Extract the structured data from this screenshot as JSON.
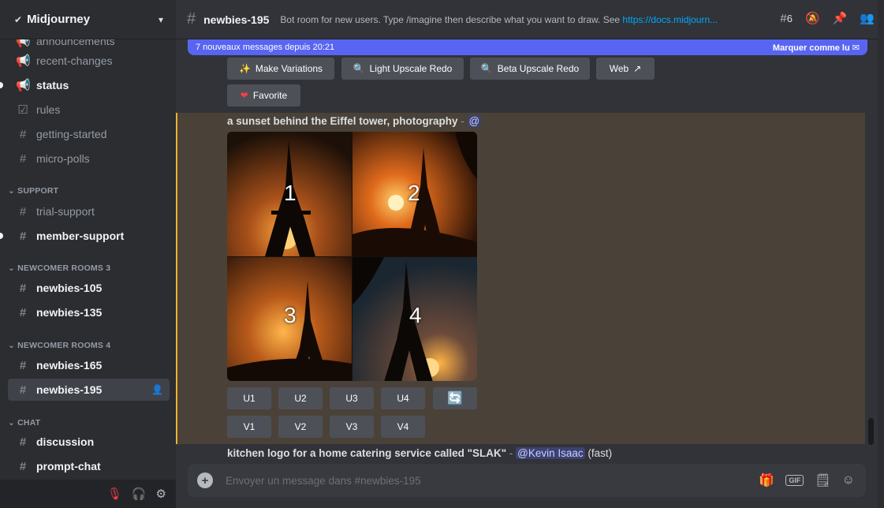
{
  "server": {
    "name": "Midjourney"
  },
  "sidebar": {
    "top_partial": "announcements",
    "channels": [
      {
        "label": "recent-changes",
        "icon": "megaphone-icon",
        "glyph": "📢"
      },
      {
        "label": "status",
        "icon": "megaphone-icon",
        "glyph": "📢",
        "unread": true
      },
      {
        "label": "rules",
        "icon": "checkbox-icon",
        "glyph": "☑"
      },
      {
        "label": "getting-started",
        "icon": "hash-icon",
        "glyph": "#"
      },
      {
        "label": "micro-polls",
        "icon": "hash-thread-icon",
        "glyph": "#"
      }
    ],
    "categories": [
      "SUPPORT",
      "NEWCOMER ROOMS 3",
      "NEWCOMER ROOMS 4",
      "CHAT"
    ],
    "support": [
      {
        "label": "trial-support",
        "icon": "forum-icon",
        "glyph": "#"
      },
      {
        "label": "member-support",
        "icon": "hash-thread-icon",
        "glyph": "#",
        "unread": true
      }
    ],
    "newcomer3": [
      {
        "label": "newbies-105",
        "icon": "forum-icon",
        "glyph": "#"
      },
      {
        "label": "newbies-135",
        "icon": "forum-icon",
        "glyph": "#"
      }
    ],
    "newcomer4": [
      {
        "label": "newbies-165",
        "icon": "forum-icon",
        "glyph": "#"
      },
      {
        "label": "newbies-195",
        "icon": "forum-icon",
        "glyph": "#",
        "active": true
      }
    ],
    "chat": [
      {
        "label": "discussion",
        "icon": "hash-icon",
        "glyph": "#"
      },
      {
        "label": "prompt-chat",
        "icon": "forum-icon",
        "glyph": "#"
      }
    ]
  },
  "topbar": {
    "channel": "newbies-195",
    "topic": "Bot room for new users. Type /imagine then describe what you want to draw. See ",
    "topic_link": "https://docs.midjourn...",
    "threads_count": "6"
  },
  "newbar": {
    "text": "7 nouveaux messages depuis 20:21",
    "mark": "Marquer comme lu"
  },
  "message_top": {
    "buttons": [
      "Make Variations",
      "Light Upscale Redo",
      "Beta Upscale Redo",
      "Web"
    ],
    "favorite": "Favorite"
  },
  "message_main": {
    "prompt": "a sunset behind the Eiffel tower, photography",
    "dash": " - ",
    "mention": "@",
    "tiles": [
      "1",
      "2",
      "3",
      "4"
    ],
    "upscale": [
      "U1",
      "U2",
      "U3",
      "U4"
    ],
    "variation": [
      "V1",
      "V2",
      "V3",
      "V4"
    ]
  },
  "message_next": {
    "prompt": "kitchen logo for a home catering service called \"SLAK\"",
    "dash": " - ",
    "mention": "@Kevin Isaac",
    "speed": " (fast)"
  },
  "composer": {
    "placeholder": "Envoyer un message dans #newbies-195"
  },
  "colors": {
    "accent": "#5865f2",
    "highlight": "#f0b132",
    "link": "#00a8fc"
  }
}
